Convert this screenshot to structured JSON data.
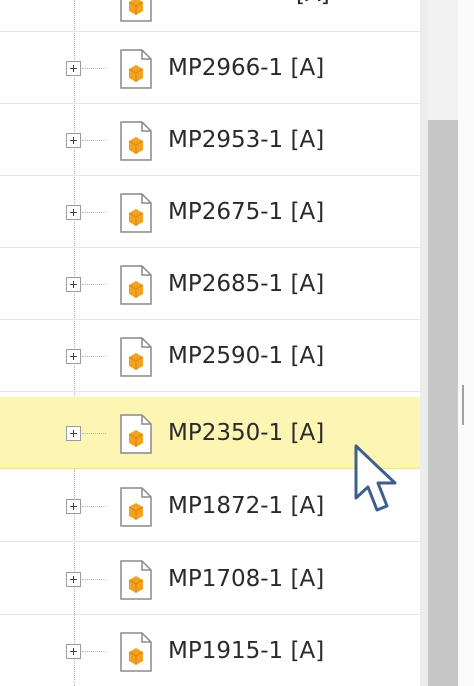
{
  "tree": {
    "partial_top_label": "[A]",
    "items": [
      {
        "label": "MP2966-1 [A]",
        "selected": false
      },
      {
        "label": "MP2953-1 [A]",
        "selected": false
      },
      {
        "label": "MP2675-1 [A]",
        "selected": false
      },
      {
        "label": "MP2685-1 [A]",
        "selected": false
      },
      {
        "label": "MP2590-1 [A]",
        "selected": false
      },
      {
        "label": "MP2350-1 [A]",
        "selected": true
      },
      {
        "label": "MP1872-1 [A]",
        "selected": false
      },
      {
        "label": "MP1708-1 [A]",
        "selected": false
      },
      {
        "label": "MP1915-1 [A]",
        "selected": false
      }
    ]
  },
  "colors": {
    "selection": "#fdf5b3",
    "icon_orange": "#f2a21f",
    "scroll_thumb": "#c6c6c6"
  },
  "icons": {
    "node": "part-document-icon",
    "expander": "plus-expand-icon",
    "cursor": "mouse-pointer-icon"
  }
}
